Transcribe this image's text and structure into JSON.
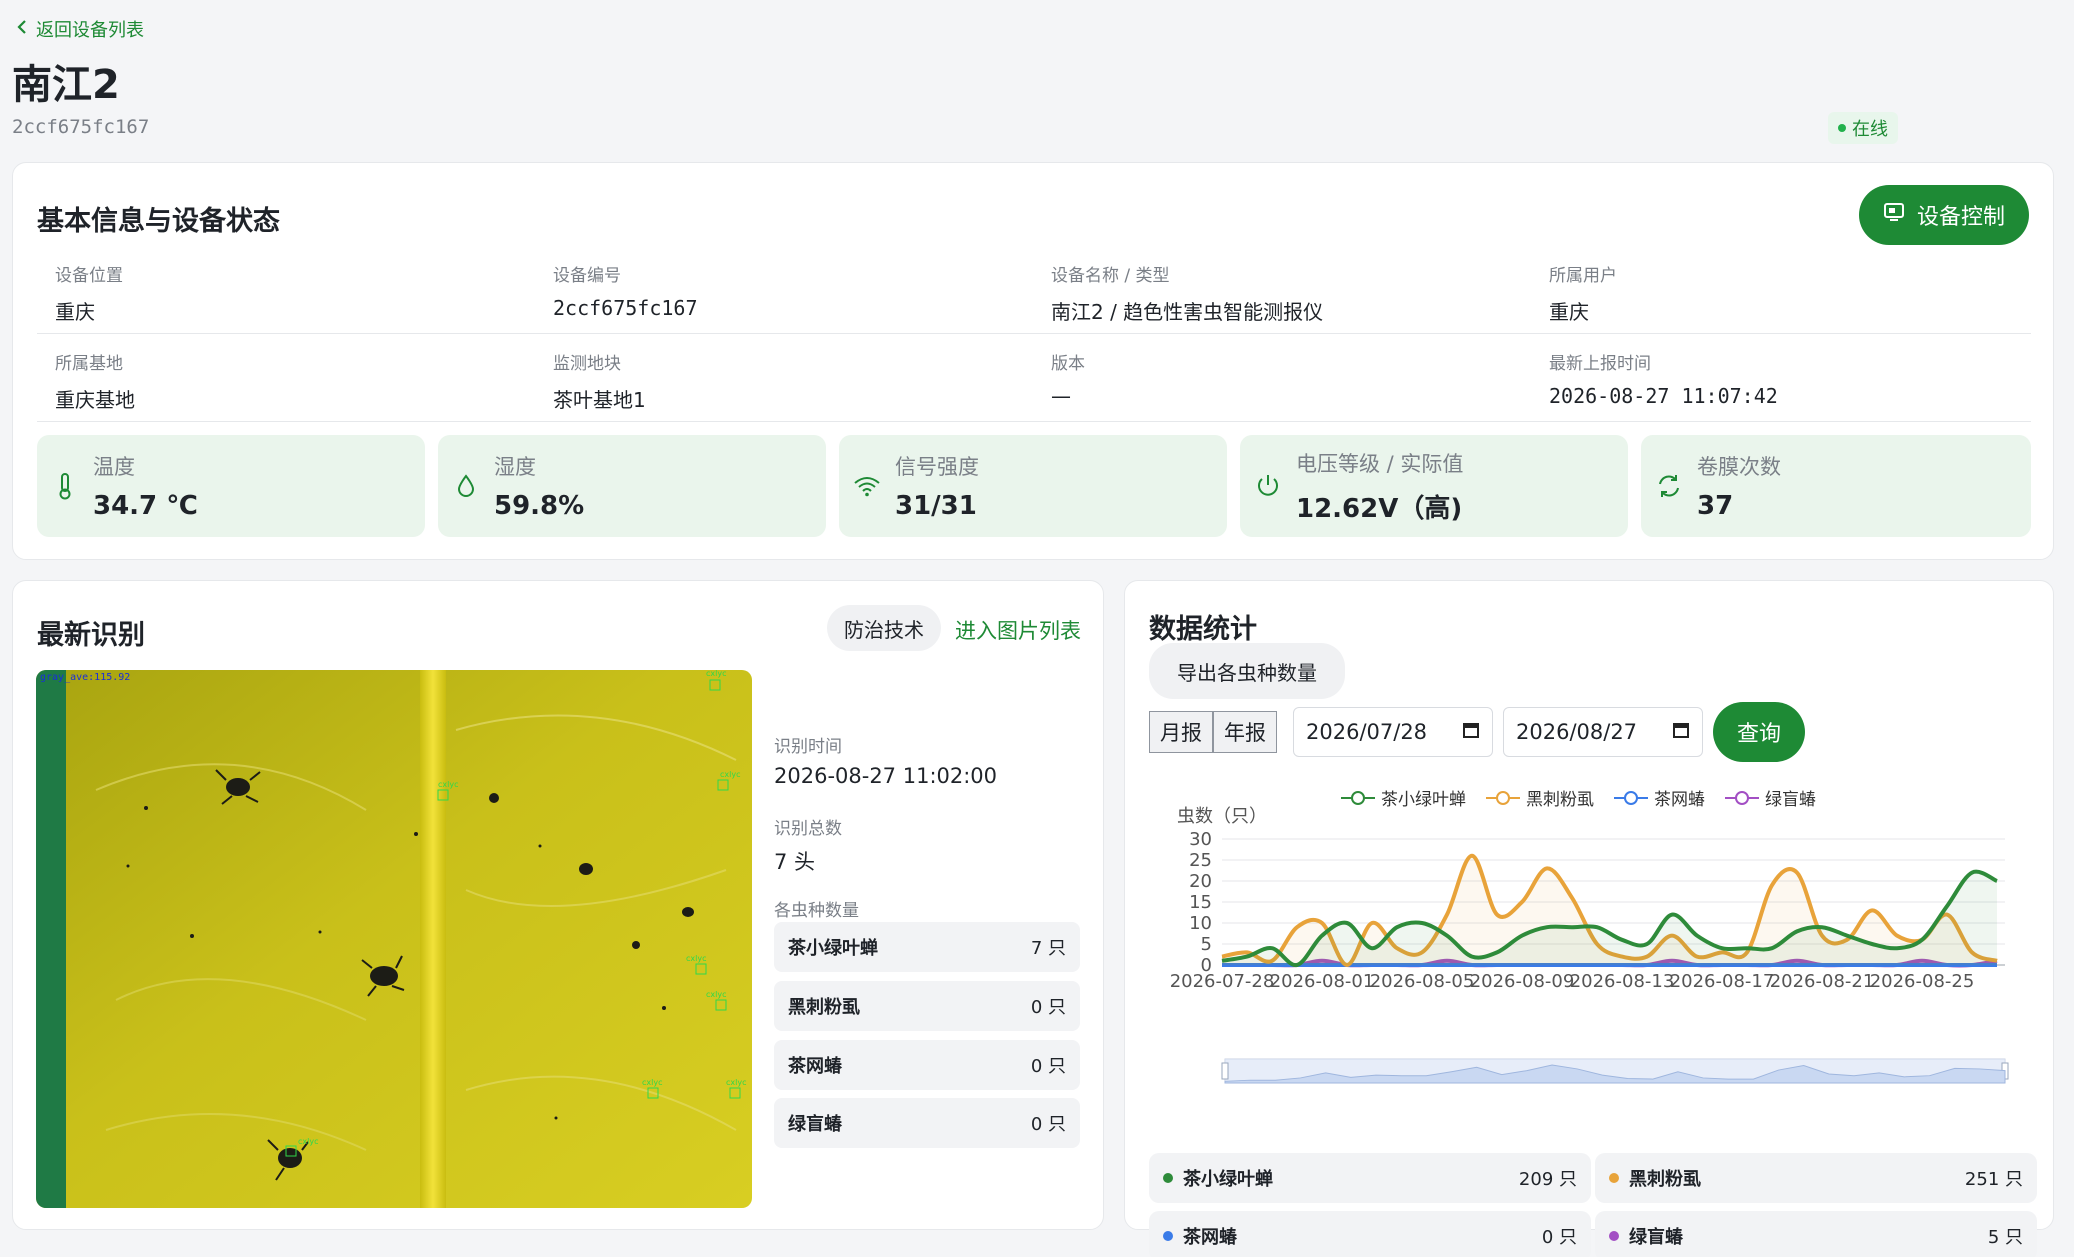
{
  "header": {
    "back_label": "返回设备列表",
    "device_name": "南江2",
    "device_id": "2ccf675fc167",
    "status": "在线"
  },
  "info": {
    "title": "基本信息与设备状态",
    "control_button": "设备控制",
    "fields": [
      {
        "label": "设备位置",
        "value": "重庆"
      },
      {
        "label": "设备编号",
        "value": "2ccf675fc167"
      },
      {
        "label": "设备名称 / 类型",
        "value": "南江2 / 趋色性害虫智能测报仪"
      },
      {
        "label": "所属用户",
        "value": "重庆"
      },
      {
        "label": "所属基地",
        "value": "重庆基地"
      },
      {
        "label": "监测地块",
        "value": "茶叶基地1"
      },
      {
        "label": "版本",
        "value": "—"
      },
      {
        "label": "最新上报时间",
        "value": "2026-08-27 11:07:42"
      }
    ],
    "stats": [
      {
        "label": "温度",
        "value": "34.7 ℃",
        "icon": "thermometer-icon"
      },
      {
        "label": "湿度",
        "value": "59.8%",
        "icon": "droplet-icon"
      },
      {
        "label": "信号强度",
        "value": "31/31",
        "icon": "wifi-icon"
      },
      {
        "label": "电压等级 / 实际值",
        "value": "12.62V（高)",
        "icon": "power-icon"
      },
      {
        "label": "卷膜次数",
        "value": "37",
        "icon": "refresh-icon"
      }
    ]
  },
  "recognition": {
    "title": "最新识别",
    "tech_button": "防治技术",
    "list_link": "进入图片列表",
    "image_overlay_text": "gray_ave:115.92",
    "box_label": "cxlyc",
    "time_label": "识别时间",
    "time_value": "2026-08-27 11:02:00",
    "total_label": "识别总数",
    "total_value": "7 头",
    "species_label": "各虫种数量",
    "species": [
      {
        "name": "茶小绿叶蝉",
        "count": "7 只"
      },
      {
        "name": "黑刺粉虱",
        "count": "0 只"
      },
      {
        "name": "茶网蝽",
        "count": "0 只"
      },
      {
        "name": "绿盲蝽",
        "count": "0 只"
      }
    ]
  },
  "stats": {
    "title": "数据统计",
    "export_button": "导出各虫种数量",
    "period_options": [
      "月报",
      "年报"
    ],
    "start_date": "2026/07/28",
    "end_date": "2026/08/27",
    "query_button": "查询",
    "summary": [
      {
        "name": "茶小绿叶蝉",
        "count": "209 只",
        "color": "#2e8b3a"
      },
      {
        "name": "黑刺粉虱",
        "count": "251 只",
        "color": "#e8a33a"
      },
      {
        "name": "茶网蝽",
        "count": "0 只",
        "color": "#3a7be8"
      },
      {
        "name": "绿盲蝽",
        "count": "5 只",
        "color": "#a34fc4"
      }
    ]
  },
  "chart_data": {
    "type": "line",
    "ylabel": "虫数（只）",
    "ylim": [
      0,
      30
    ],
    "yticks": [
      0,
      5,
      10,
      15,
      20,
      25,
      30
    ],
    "xtick_labels": [
      "2026-07-28",
      "2026-08-01",
      "2026-08-05",
      "2026-08-09",
      "2026-08-13",
      "2026-08-17",
      "2026-08-21",
      "2026-08-25"
    ],
    "x": [
      "07-28",
      "07-29",
      "07-30",
      "07-31",
      "08-01",
      "08-02",
      "08-03",
      "08-04",
      "08-05",
      "08-06",
      "08-07",
      "08-08",
      "08-09",
      "08-10",
      "08-11",
      "08-12",
      "08-13",
      "08-14",
      "08-15",
      "08-16",
      "08-17",
      "08-18",
      "08-19",
      "08-20",
      "08-21",
      "08-22",
      "08-23",
      "08-24",
      "08-25",
      "08-26",
      "08-27"
    ],
    "legend_position": "top",
    "series": [
      {
        "name": "茶小绿叶蝉",
        "color": "#2e8b3a",
        "values": [
          1,
          2,
          4,
          0,
          7,
          10,
          4,
          9,
          10,
          7,
          2,
          3,
          7,
          9,
          9,
          9,
          6,
          5,
          12,
          7,
          4,
          4,
          4,
          8,
          9,
          7,
          5,
          4,
          6,
          14,
          22,
          20
        ]
      },
      {
        "name": "黑刺粉虱",
        "color": "#e8a33a",
        "values": [
          2,
          3,
          1,
          9,
          10,
          0,
          10,
          4,
          3,
          12,
          26,
          12,
          15,
          23,
          16,
          5,
          2,
          2,
          7,
          2,
          3,
          3,
          19,
          22,
          7,
          6,
          13,
          7,
          6,
          12,
          3,
          1
        ]
      },
      {
        "name": "茶网蝽",
        "color": "#3a7be8",
        "values": [
          0,
          0,
          0,
          0,
          0,
          0,
          0,
          0,
          0,
          0,
          0,
          0,
          0,
          0,
          0,
          0,
          0,
          0,
          0,
          0,
          0,
          0,
          0,
          0,
          0,
          0,
          0,
          0,
          0,
          0,
          0,
          0
        ]
      },
      {
        "name": "绿盲蝽",
        "color": "#a34fc4",
        "values": [
          0,
          0,
          0,
          0,
          1,
          0,
          0,
          0,
          0,
          1,
          0,
          0,
          0,
          0,
          0,
          0,
          0,
          0,
          1,
          0,
          0,
          0,
          0,
          1,
          0,
          0,
          0,
          0,
          1,
          0,
          0,
          1
        ]
      }
    ]
  }
}
